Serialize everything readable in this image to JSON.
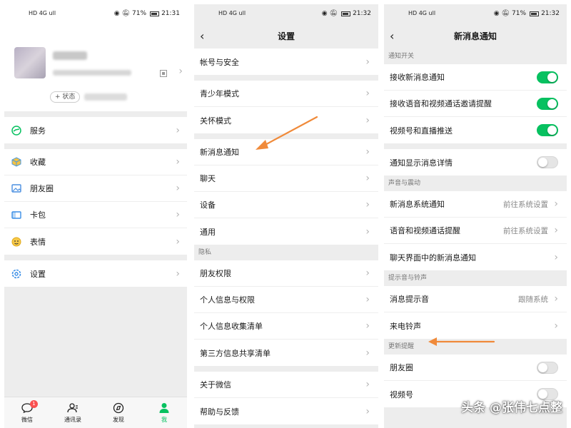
{
  "status_bar": {
    "left_1": "HD 4G ull",
    "left_2": "HD 4G ull",
    "left_3": "HD 4G ull",
    "battery_1": "71%",
    "battery_3": "71%",
    "time_1": "21:31",
    "time_2": "21:32",
    "time_3": "21:32"
  },
  "me": {
    "status_chip": "+ 状态",
    "menu": [
      {
        "label": "服务",
        "icon": "service-icon"
      },
      {
        "label": "收藏",
        "icon": "favorites-icon"
      },
      {
        "label": "朋友圈",
        "icon": "moments-icon"
      },
      {
        "label": "卡包",
        "icon": "card-wallet-icon"
      },
      {
        "label": "表情",
        "icon": "sticker-icon"
      },
      {
        "label": "设置",
        "icon": "settings-icon"
      }
    ],
    "tabs": [
      {
        "label": "微信",
        "badge": "1"
      },
      {
        "label": "通讯录"
      },
      {
        "label": "发现"
      },
      {
        "label": "我"
      }
    ]
  },
  "settings": {
    "title": "设置",
    "group1": [
      "帐号与安全"
    ],
    "group2": [
      "青少年模式",
      "关怀模式"
    ],
    "group3": [
      "新消息通知",
      "聊天",
      "设备",
      "通用"
    ],
    "privacy_header": "隐私",
    "group4": [
      "朋友权限",
      "个人信息与权限",
      "个人信息收集清单",
      "第三方信息共享清单"
    ],
    "group5": [
      "关于微信",
      "帮助与反馈"
    ]
  },
  "notifications": {
    "title": "新消息通知",
    "sec1": "通知开关",
    "rows1": [
      {
        "label": "接收新消息通知",
        "on": true
      },
      {
        "label": "接收语音和视频通话邀请提醒",
        "on": true
      },
      {
        "label": "视频号和直播推送",
        "on": true
      }
    ],
    "detail_row": {
      "label": "通知显示消息详情",
      "on": false
    },
    "sec2": "声音与震动",
    "rows2": [
      {
        "label": "新消息系统通知",
        "value": "前往系统设置"
      },
      {
        "label": "语音和视频通话提醒",
        "value": "前往系统设置"
      },
      {
        "label": "聊天界面中的新消息通知",
        "value": ""
      }
    ],
    "sec3": "提示音与铃声",
    "rows3": [
      {
        "label": "消息提示音",
        "value": "跟随系统"
      },
      {
        "label": "来电铃声",
        "value": ""
      }
    ],
    "sec4": "更新提醒",
    "rows4": [
      {
        "label": "朋友圈",
        "on": false
      },
      {
        "label": "视频号",
        "on": false
      }
    ]
  },
  "watermark": "头条 @张伟七点整",
  "colors": {
    "accent": "#07c160",
    "arrow": "#f08a3a",
    "badge": "#fa5151"
  }
}
